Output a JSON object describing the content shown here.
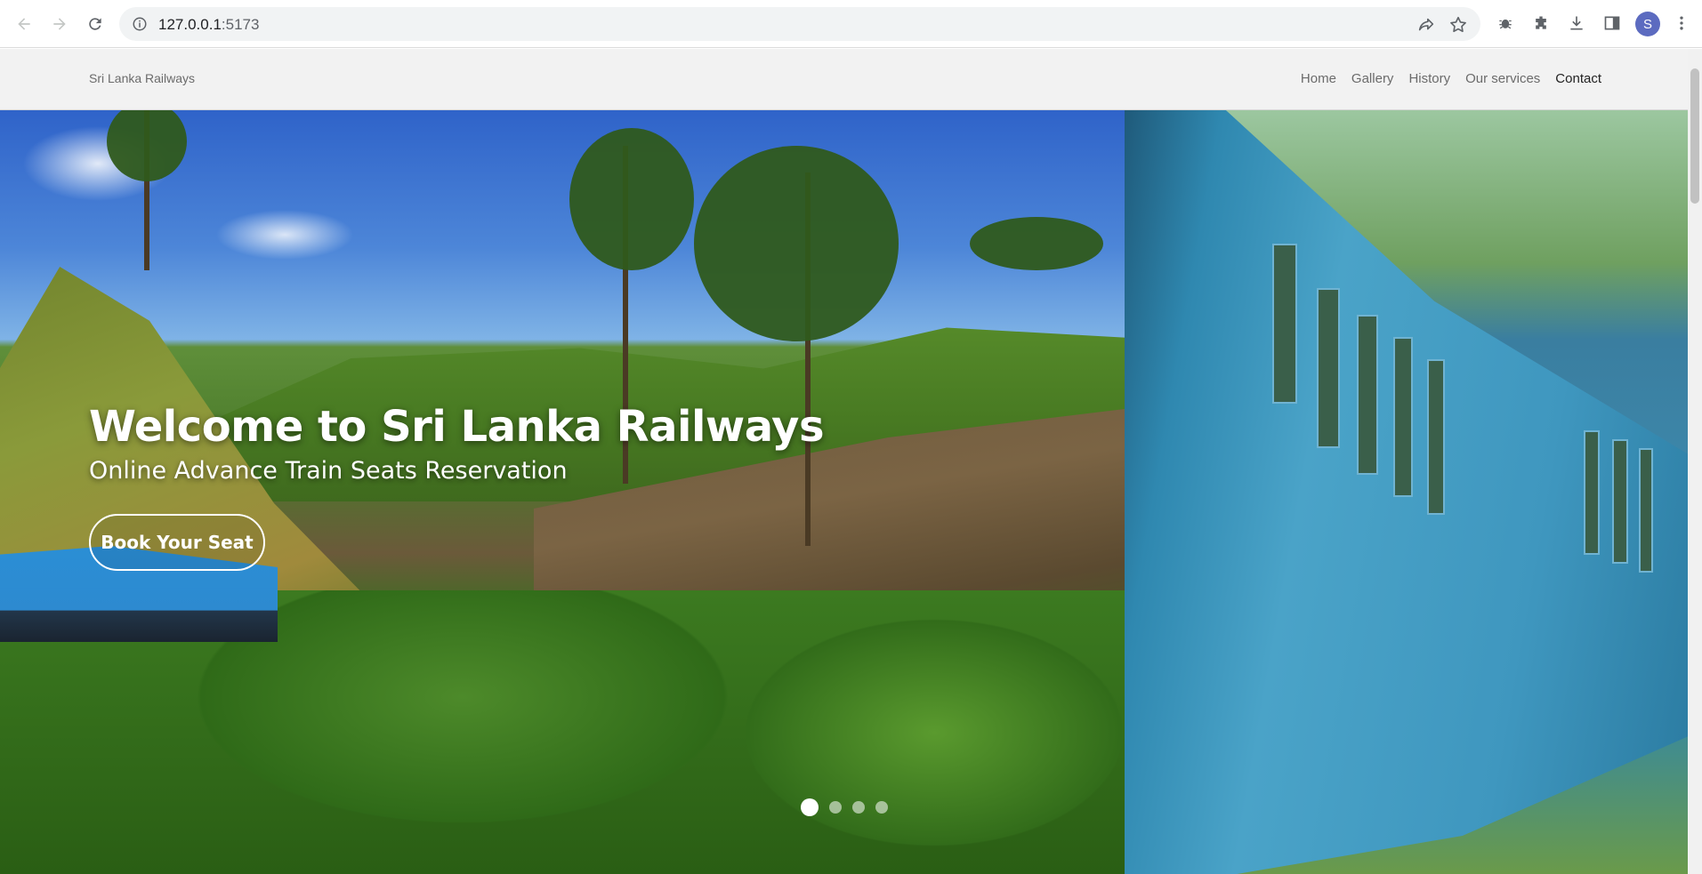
{
  "browser": {
    "url_host": "127.0.0.1",
    "url_port": ":5173",
    "profile_initial": "S",
    "icons": [
      "back-icon",
      "forward-icon",
      "reload-icon",
      "info-icon",
      "share-icon",
      "star-icon",
      "bug-icon",
      "extensions-icon",
      "download-icon",
      "sidepanel-icon",
      "kebab-menu-icon"
    ]
  },
  "navbar": {
    "brand": "Sri Lanka Railways",
    "links": [
      {
        "label": "Home",
        "active": false
      },
      {
        "label": "Gallery",
        "active": false
      },
      {
        "label": "History",
        "active": false
      },
      {
        "label": "Our services",
        "active": false
      },
      {
        "label": "Contact",
        "active": true
      }
    ]
  },
  "hero": {
    "title": "Welcome to Sri Lanka Railways",
    "subtitle": "Online Advance Train Seats Reservation",
    "cta": "Book Your Seat",
    "slides_total": 4,
    "active_slide": 1
  },
  "colors": {
    "navbar_bg": "#f2f2f2",
    "link_muted": "#6b6b6b",
    "link_active": "#222222",
    "profile_bg": "#5c6bc0"
  }
}
